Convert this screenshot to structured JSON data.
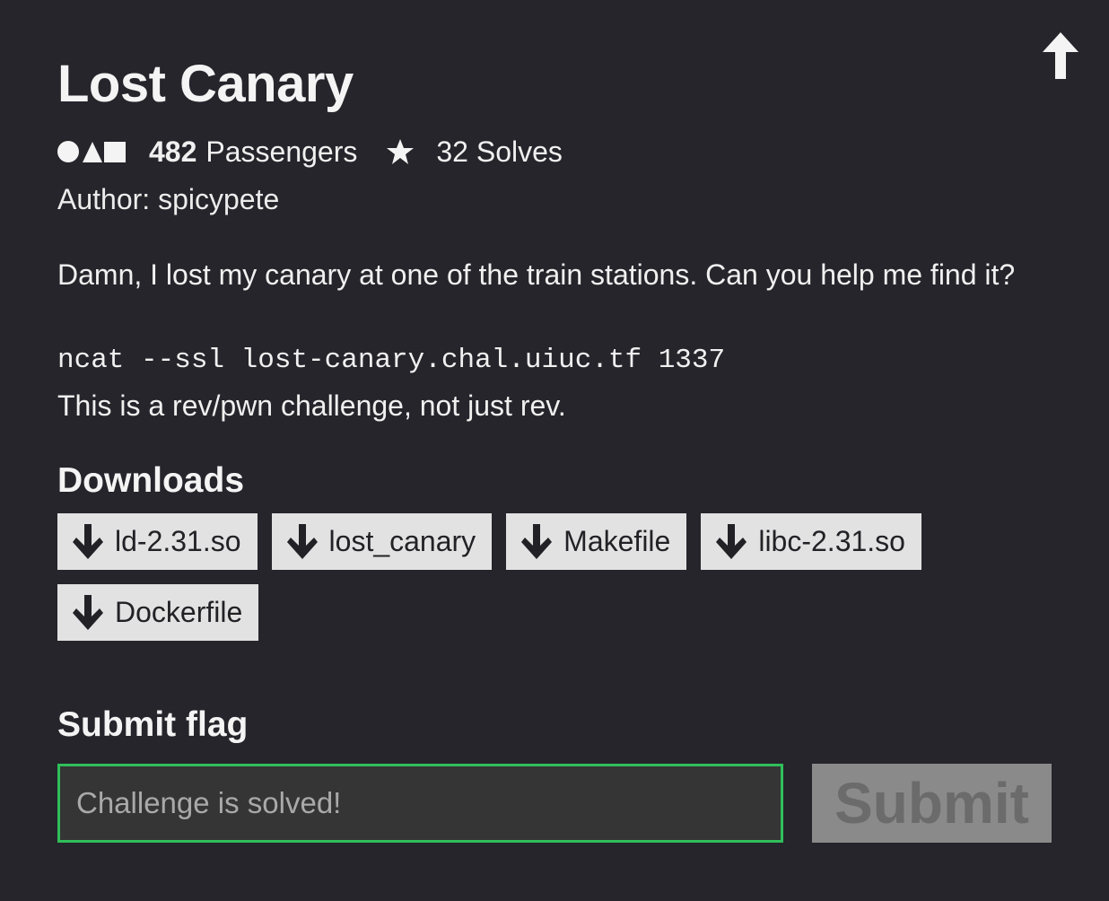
{
  "challenge": {
    "title": "Lost Canary",
    "passengers_count": "482",
    "passengers_label": "Passengers",
    "solves_label": "32 Solves",
    "author_line": "Author: spicypete",
    "description": "Damn, I lost my canary at one of the train stations. Can you help me find it?",
    "command": "ncat --ssl lost-canary.chal.uiuc.tf 1337",
    "note": "This is a rev/pwn challenge, not just rev."
  },
  "downloads": {
    "heading": "Downloads",
    "files": [
      "ld-2.31.so",
      "lost_canary",
      "Makefile",
      "libc-2.31.so",
      "Dockerfile"
    ]
  },
  "submit_flag": {
    "heading": "Submit flag",
    "placeholder": "Challenge is solved!",
    "value": "",
    "button_label": "Submit"
  },
  "icons": {
    "up": "arrow-up-icon",
    "category": "shapes-icon",
    "solves": "star-icon",
    "download": "arrow-down-icon"
  },
  "colors": {
    "background": "#26252b",
    "input_border": "#2fbf5a",
    "button_bg": "#e2e2e2",
    "submit_disabled_bg": "#8a8a8a"
  }
}
